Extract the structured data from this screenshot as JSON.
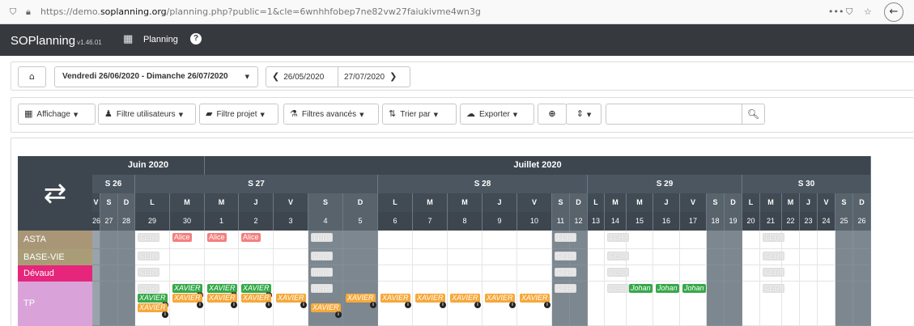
{
  "browser": {
    "url_prefix": "https://demo.",
    "url_domain": "soplanning.org",
    "url_suffix": "/planning.php?public=1&cle=6wnhhfobep7ne82vw27faiukivme4wn3g",
    "menu_dots": "•••"
  },
  "app": {
    "brand": "SOPlanning",
    "version": "v1.46.01",
    "menu_planning": "Planning"
  },
  "daterange": {
    "selected": "Vendredi 26/06/2020 - Dimanche 26/07/2020",
    "prev_date": "26/05/2020",
    "next_date": "27/07/2020"
  },
  "toolbar": {
    "affichage": "Affichage",
    "filtre_utilisateurs": "Filtre utilisateurs",
    "filtre_projet": "Filtre projet",
    "filtres_avances": "Filtres avancés",
    "trier_par": "Trier par",
    "exporter": "Exporter",
    "search_value": ""
  },
  "colors": {
    "header_dark": "#3d464f",
    "row_asta": "#a89676",
    "row_basevie": "#a99d78",
    "row_devaud": "#e5267b",
    "row_tp": "#d9a3d9",
    "fer": "#e6e6e6",
    "alice": "#f47f7f",
    "xavier_green": "#36a84a",
    "xavier_orange": "#f6a83a"
  },
  "months": [
    {
      "label": "Juin 2020",
      "from": 0,
      "to": 5
    },
    {
      "label": "Juillet 2020",
      "from": 5,
      "to": 31
    }
  ],
  "weeks": [
    {
      "label": "S 26",
      "from": 0,
      "to": 3
    },
    {
      "label": "S 27",
      "from": 3,
      "to": 10
    },
    {
      "label": "S 28",
      "from": 10,
      "to": 17
    },
    {
      "label": "S 29",
      "from": 17,
      "to": 24
    },
    {
      "label": "S 30",
      "from": 24,
      "to": 31
    }
  ],
  "days": [
    {
      "d": "V",
      "n": "26",
      "we": false
    },
    {
      "d": "S",
      "n": "27",
      "we": true
    },
    {
      "d": "D",
      "n": "28",
      "we": true
    },
    {
      "d": "L",
      "n": "29",
      "we": false
    },
    {
      "d": "M",
      "n": "30",
      "we": false
    },
    {
      "d": "M",
      "n": "1",
      "we": false
    },
    {
      "d": "J",
      "n": "2",
      "we": false
    },
    {
      "d": "V",
      "n": "3",
      "we": false
    },
    {
      "d": "S",
      "n": "4",
      "we": true
    },
    {
      "d": "D",
      "n": "5",
      "we": true
    },
    {
      "d": "L",
      "n": "6",
      "we": false
    },
    {
      "d": "M",
      "n": "7",
      "we": false
    },
    {
      "d": "M",
      "n": "8",
      "we": false
    },
    {
      "d": "J",
      "n": "9",
      "we": false
    },
    {
      "d": "V",
      "n": "10",
      "we": false
    },
    {
      "d": "S",
      "n": "11",
      "we": true
    },
    {
      "d": "D",
      "n": "12",
      "we": true
    },
    {
      "d": "L",
      "n": "13",
      "we": false
    },
    {
      "d": "M",
      "n": "14",
      "we": false
    },
    {
      "d": "M",
      "n": "15",
      "we": false
    },
    {
      "d": "J",
      "n": "16",
      "we": false
    },
    {
      "d": "V",
      "n": "17",
      "we": false
    },
    {
      "d": "S",
      "n": "18",
      "we": true
    },
    {
      "d": "D",
      "n": "19",
      "we": true
    },
    {
      "d": "L",
      "n": "20",
      "we": false
    },
    {
      "d": "M",
      "n": "21",
      "we": false
    },
    {
      "d": "M",
      "n": "22",
      "we": false
    },
    {
      "d": "J",
      "n": "23",
      "we": false
    },
    {
      "d": "V",
      "n": "24",
      "we": false
    },
    {
      "d": "S",
      "n": "25",
      "we": true
    },
    {
      "d": "D",
      "n": "26",
      "we": true
    }
  ],
  "rows": [
    {
      "label": "ASTA",
      "color": "#a89676"
    },
    {
      "label": "BASE-VIE",
      "color": "#a99d78"
    },
    {
      "label": "Dévaud",
      "color": "#e5267b"
    },
    {
      "label": "TP",
      "color": "#d9a3d9"
    }
  ],
  "tasks": [
    {
      "row": 0,
      "day": 3,
      "text": "FER.",
      "kind": "fer",
      "line": 0
    },
    {
      "row": 0,
      "day": 4,
      "text": "Alice",
      "kind": "alice",
      "line": 0
    },
    {
      "row": 0,
      "day": 5,
      "text": "Alice",
      "kind": "alice",
      "line": 0
    },
    {
      "row": 0,
      "day": 6,
      "text": "Alice",
      "kind": "alice",
      "line": 0
    },
    {
      "row": 0,
      "day": 8,
      "text": "FER.",
      "kind": "fer",
      "line": 0
    },
    {
      "row": 0,
      "day": 15,
      "text": "FER.",
      "kind": "fer",
      "line": 0
    },
    {
      "row": 0,
      "day": 18,
      "text": "FER.",
      "kind": "fer",
      "line": 0
    },
    {
      "row": 0,
      "day": 25,
      "text": "FER.",
      "kind": "fer",
      "line": 0
    },
    {
      "row": 1,
      "day": 3,
      "text": "FER.",
      "kind": "fer",
      "line": 0
    },
    {
      "row": 1,
      "day": 8,
      "text": "FER.",
      "kind": "fer",
      "line": 0
    },
    {
      "row": 1,
      "day": 15,
      "text": "FER.",
      "kind": "fer",
      "line": 0
    },
    {
      "row": 1,
      "day": 18,
      "text": "FER.",
      "kind": "fer",
      "line": 0
    },
    {
      "row": 1,
      "day": 25,
      "text": "FER.",
      "kind": "fer",
      "line": 0
    },
    {
      "row": 2,
      "day": 3,
      "text": "FER.",
      "kind": "fer",
      "line": 0
    },
    {
      "row": 2,
      "day": 8,
      "text": "FER.",
      "kind": "fer",
      "line": 0
    },
    {
      "row": 2,
      "day": 15,
      "text": "FER.",
      "kind": "fer",
      "line": 0
    },
    {
      "row": 2,
      "day": 18,
      "text": "FER.",
      "kind": "fer",
      "line": 0
    },
    {
      "row": 2,
      "day": 25,
      "text": "FER.",
      "kind": "fer",
      "line": 0
    },
    {
      "row": 3,
      "day": 3,
      "text": "FER.",
      "kind": "fer",
      "line": 0
    },
    {
      "row": 3,
      "day": 3,
      "text": "XAVIER",
      "kind": "xgreen",
      "line": 1
    },
    {
      "row": 3,
      "day": 3,
      "text": "XAVIER",
      "kind": "xorange",
      "line": 2
    },
    {
      "row": 3,
      "day": 4,
      "text": "XAVIER",
      "kind": "xgreen",
      "line": 0
    },
    {
      "row": 3,
      "day": 4,
      "text": "XAVIER",
      "kind": "xorange",
      "line": 1
    },
    {
      "row": 3,
      "day": 5,
      "text": "XAVIER",
      "kind": "xgreen",
      "line": 0
    },
    {
      "row": 3,
      "day": 5,
      "text": "XAVIER",
      "kind": "xorange",
      "line": 1
    },
    {
      "row": 3,
      "day": 6,
      "text": "XAVIER",
      "kind": "xgreen",
      "line": 0
    },
    {
      "row": 3,
      "day": 6,
      "text": "XAVIER",
      "kind": "xorange",
      "line": 1
    },
    {
      "row": 3,
      "day": 7,
      "text": "XAVIER",
      "kind": "xorange",
      "line": 1
    },
    {
      "row": 3,
      "day": 8,
      "text": "FER.",
      "kind": "fer",
      "line": 0
    },
    {
      "row": 3,
      "day": 8,
      "text": "XAVIER",
      "kind": "xorange",
      "line": 2
    },
    {
      "row": 3,
      "day": 9,
      "text": "XAVIER",
      "kind": "xorange",
      "line": 1
    },
    {
      "row": 3,
      "day": 10,
      "text": "XAVIER",
      "kind": "xorange",
      "line": 1
    },
    {
      "row": 3,
      "day": 11,
      "text": "XAVIER",
      "kind": "xorange",
      "line": 1
    },
    {
      "row": 3,
      "day": 12,
      "text": "XAVIER",
      "kind": "xorange",
      "line": 1
    },
    {
      "row": 3,
      "day": 13,
      "text": "XAVIER",
      "kind": "xorange",
      "line": 1
    },
    {
      "row": 3,
      "day": 14,
      "text": "XAVIER",
      "kind": "xorange",
      "line": 1
    },
    {
      "row": 3,
      "day": 15,
      "text": "FER.",
      "kind": "fer",
      "line": 0
    },
    {
      "row": 3,
      "day": 18,
      "text": "FER.",
      "kind": "fer",
      "line": 0
    },
    {
      "row": 3,
      "day": 19,
      "text": "Johan",
      "kind": "johan",
      "line": 0
    },
    {
      "row": 3,
      "day": 20,
      "text": "Johan",
      "kind": "johan",
      "line": 0
    },
    {
      "row": 3,
      "day": 21,
      "text": "Johan",
      "kind": "johan",
      "line": 0
    },
    {
      "row": 3,
      "day": 25,
      "text": "FER.",
      "kind": "fer",
      "line": 0
    }
  ]
}
